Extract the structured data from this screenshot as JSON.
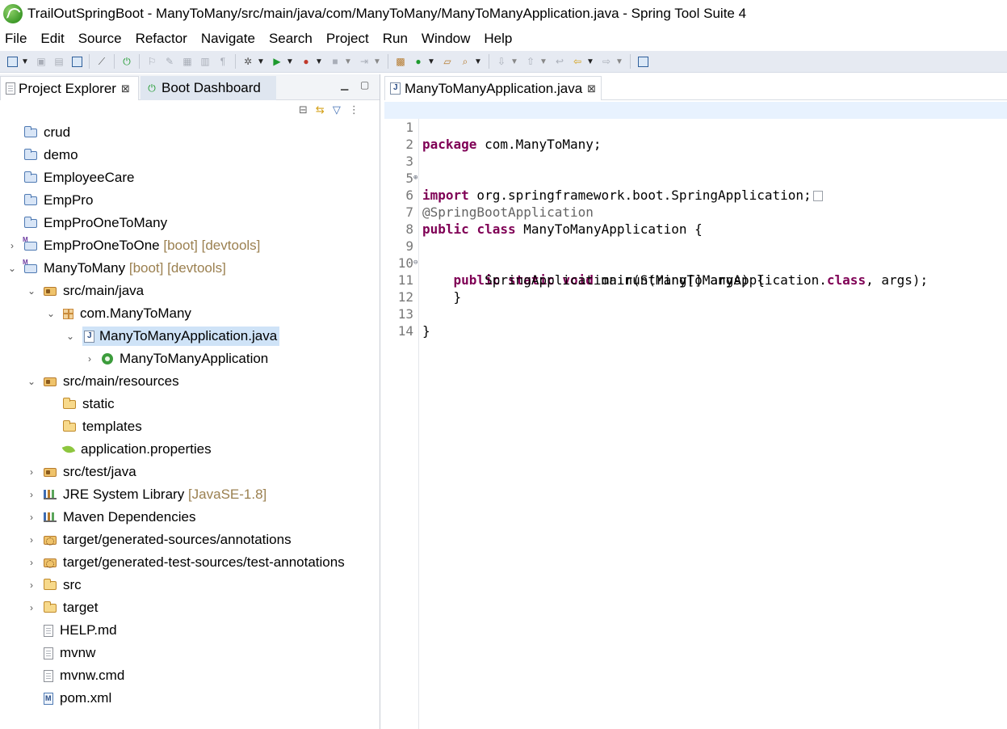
{
  "window": {
    "title": "TrailOutSpringBoot - ManyToMany/src/main/java/com/ManyToMany/ManyToManyApplication.java - Spring Tool Suite 4"
  },
  "menu": [
    "File",
    "Edit",
    "Source",
    "Refactor",
    "Navigate",
    "Search",
    "Project",
    "Run",
    "Window",
    "Help"
  ],
  "left_panel": {
    "tabs": [
      {
        "label": "Project Explorer",
        "close": "⊠"
      },
      {
        "label": "Boot Dashboard"
      }
    ],
    "tree": [
      {
        "label": "crud",
        "icon": "folder-icon"
      },
      {
        "label": "demo",
        "icon": "folder-icon"
      },
      {
        "label": "EmployeeCare",
        "icon": "folder-icon"
      },
      {
        "label": "EmpPro",
        "icon": "folder-icon"
      },
      {
        "label": "EmpProOneToMany",
        "icon": "folder-icon"
      },
      {
        "label": "EmpProOneToOne",
        "decoration": "[boot] [devtools]",
        "icon": "maven-project-icon"
      },
      {
        "label": "ManyToMany",
        "decoration": "[boot] [devtools]",
        "icon": "maven-project-icon"
      },
      {
        "label": "src/main/java",
        "icon": "source-folder-icon"
      },
      {
        "label": "com.ManyToMany",
        "icon": "package-icon"
      },
      {
        "label": "ManyToManyApplication.java",
        "icon": "java-file-icon"
      },
      {
        "label": "ManyToManyApplication",
        "icon": "spring-class-icon"
      },
      {
        "label": "src/main/resources",
        "icon": "source-folder-icon"
      },
      {
        "label": "static",
        "icon": "open-folder-icon"
      },
      {
        "label": "templates",
        "icon": "open-folder-icon"
      },
      {
        "label": "application.properties",
        "icon": "leaf-icon"
      },
      {
        "label": "src/test/java",
        "icon": "source-folder-icon"
      },
      {
        "label": "JRE System Library",
        "decoration": "[JavaSE-1.8]",
        "icon": "library-icon"
      },
      {
        "label": "Maven Dependencies",
        "icon": "library-icon"
      },
      {
        "label": "target/generated-sources/annotations",
        "icon": "generated-source-folder-icon"
      },
      {
        "label": "target/generated-test-sources/test-annotations",
        "icon": "generated-source-folder-icon"
      },
      {
        "label": "src",
        "icon": "open-folder-icon"
      },
      {
        "label": "target",
        "icon": "open-folder-icon"
      },
      {
        "label": "HELP.md",
        "icon": "file-icon"
      },
      {
        "label": "mvnw",
        "icon": "file-icon"
      },
      {
        "label": "mvnw.cmd",
        "icon": "file-icon"
      },
      {
        "label": "pom.xml",
        "icon": "pom-file-icon"
      }
    ]
  },
  "editor": {
    "tab": {
      "label": "ManyToManyApplication.java",
      "close": "⊠"
    },
    "lines": [
      {
        "n": "1",
        "kw1": "package",
        "rest": " com.ManyToMany;"
      },
      {
        "n": "2"
      },
      {
        "n": "3",
        "kw1": "import",
        "rest": " org.springframework.boot.SpringApplication;"
      },
      {
        "n": "5"
      },
      {
        "n": "6",
        "anno": "@SpringBootApplication"
      },
      {
        "n": "7",
        "kw1": "public",
        "kw2": "class",
        "rest": " ManyToManyApplication {"
      },
      {
        "n": "8"
      },
      {
        "n": "9",
        "indent": "    ",
        "kw1": "public",
        "kw2": "static",
        "kw3": "void",
        "rest": " main(String[] args) {"
      },
      {
        "n": "10",
        "pre": "        SpringApplication.run(ManyToManyApplication.",
        "kw1": "class",
        "rest": ", args);"
      },
      {
        "n": "11",
        "pre": "    }"
      },
      {
        "n": "12"
      },
      {
        "n": "13",
        "pre": "}"
      },
      {
        "n": "14"
      }
    ]
  }
}
